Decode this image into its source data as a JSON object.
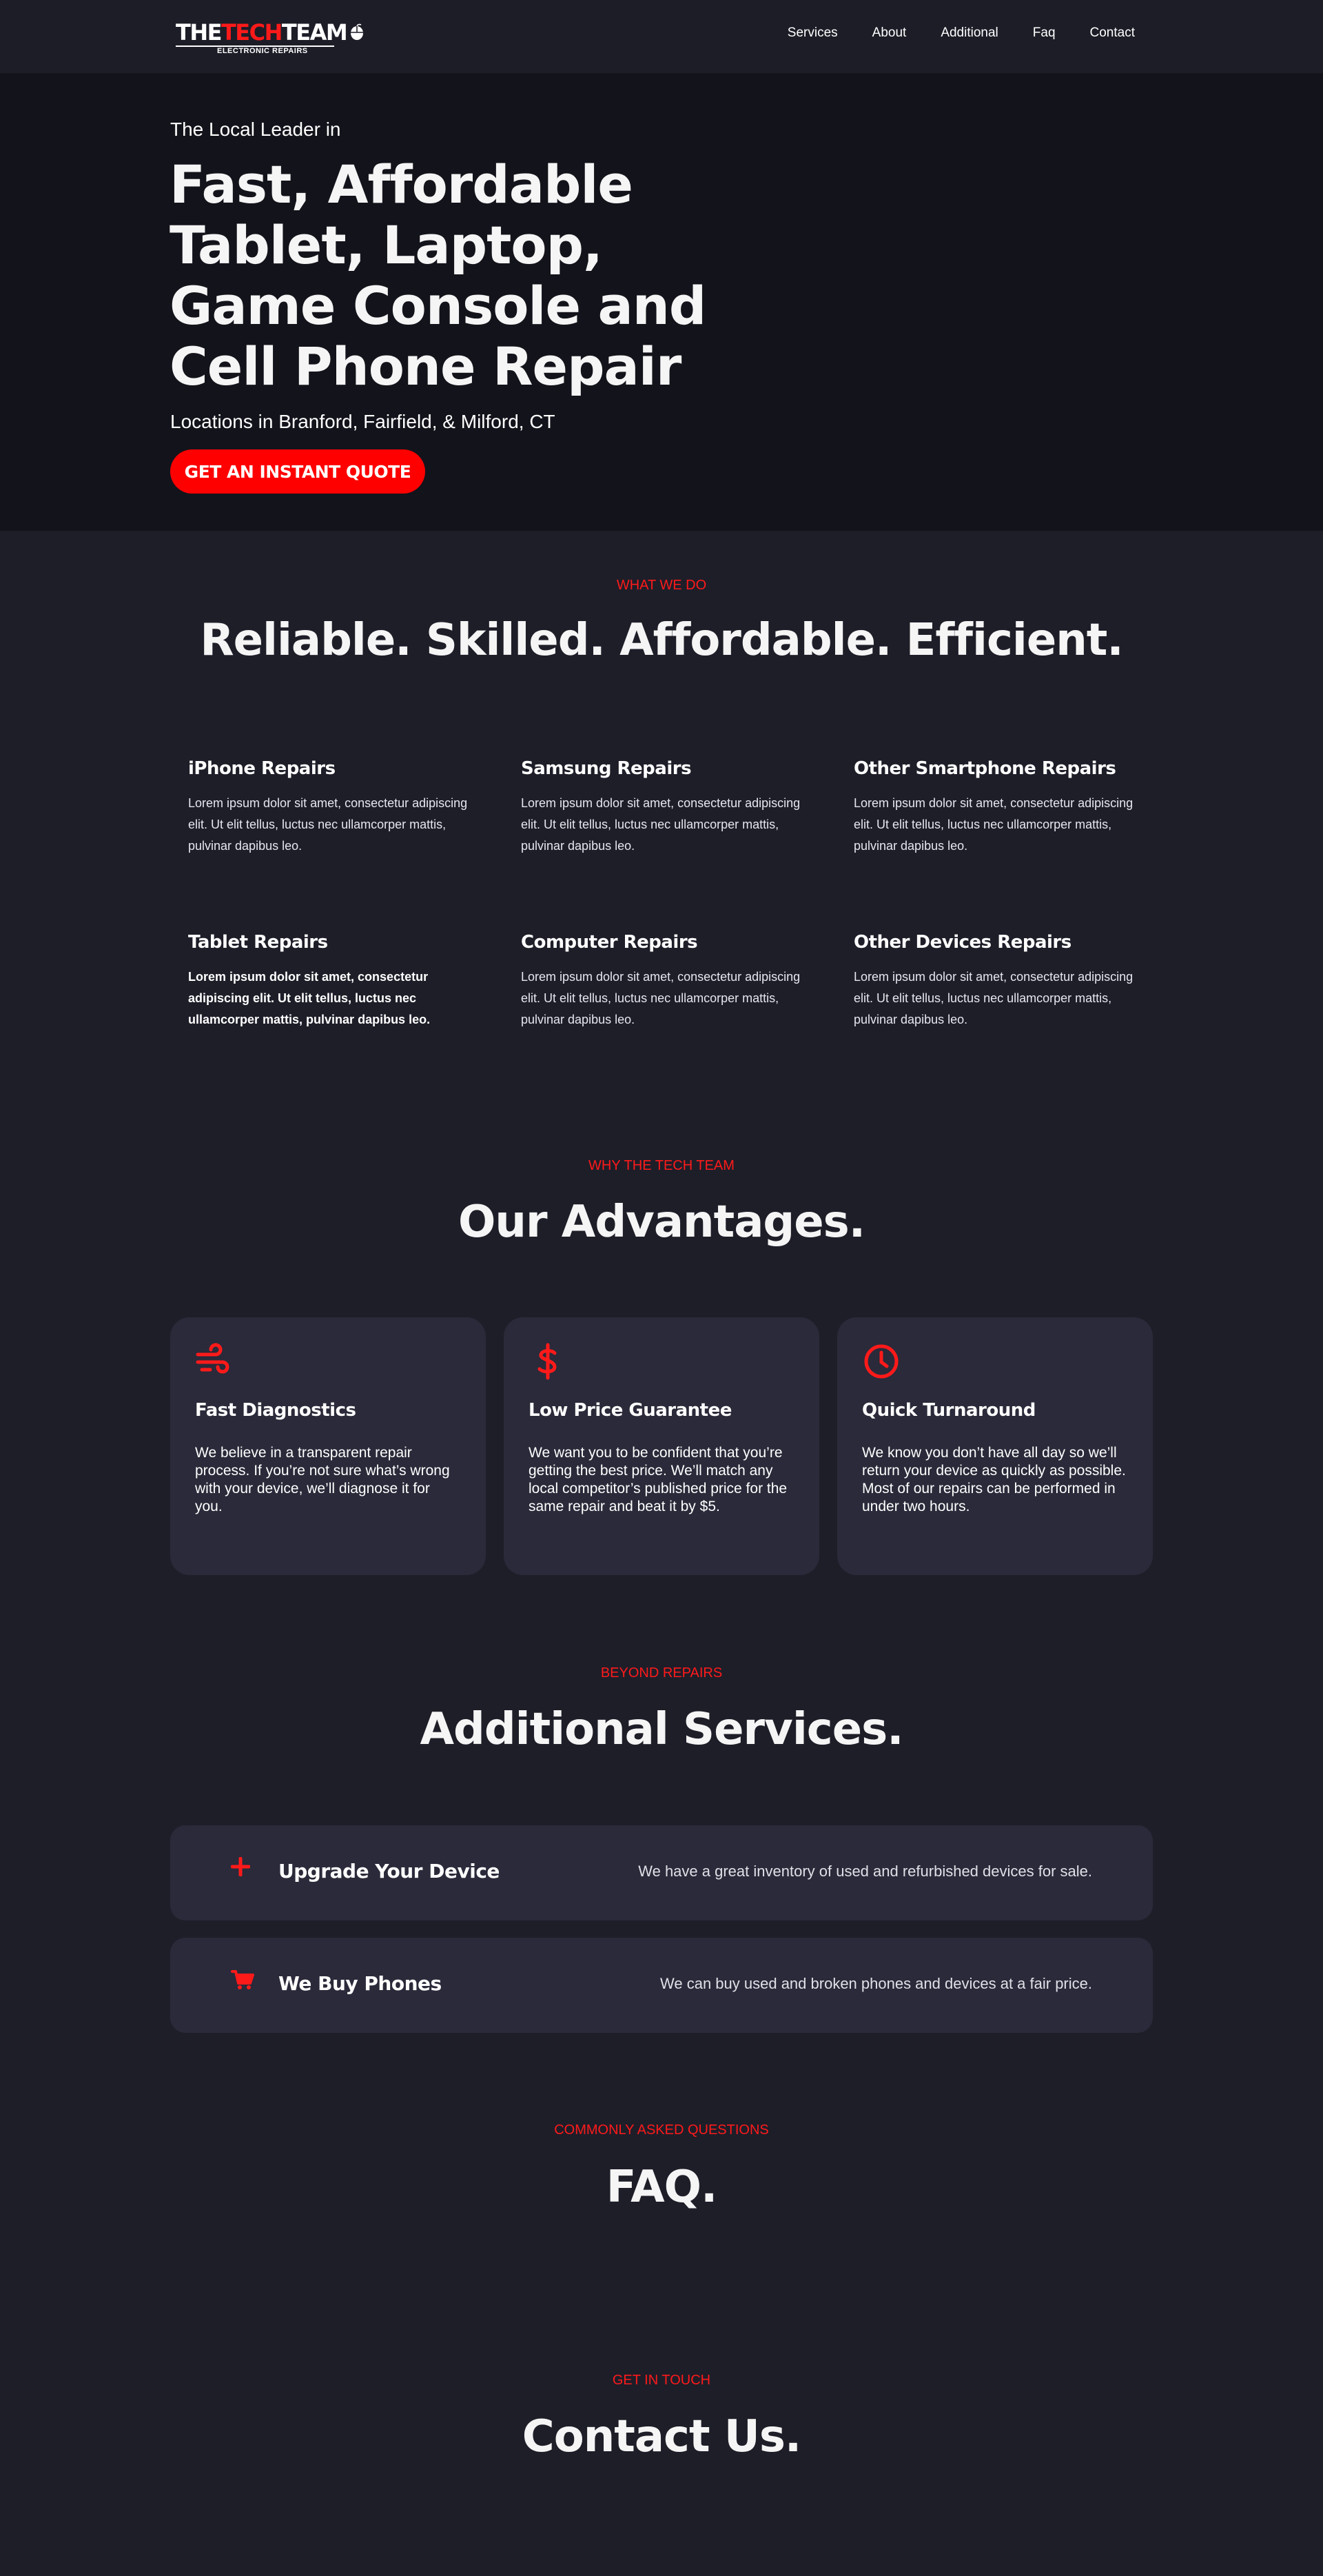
{
  "brand": {
    "name_part1": "THE",
    "name_part2": "TECH",
    "name_part3": "TEAM",
    "tagline": "ELECTRONIC REPAIRS"
  },
  "nav": [
    "Services",
    "About",
    "Additional",
    "Faq",
    "Contact"
  ],
  "hero": {
    "pre": "The Local Leader in",
    "title": "Fast, Affordable Tablet, Laptop, Game Console and Cell Phone Repair",
    "locations": "Locations in Branford, Fairfield, & Milford, CT",
    "cta": "GET AN INSTANT QUOTE"
  },
  "services": {
    "eyebrow": "WHAT WE DO",
    "title": "Reliable. Skilled. Affordable. Efficient.",
    "items": [
      {
        "title": "iPhone Repairs",
        "text": "Lorem ipsum dolor sit amet, consectetur adipiscing elit. Ut elit tellus, luctus nec ullamcorper mattis, pulvinar dapibus leo."
      },
      {
        "title": "Samsung Repairs",
        "text": "Lorem ipsum dolor sit amet, consectetur adipiscing elit. Ut elit tellus, luctus nec ullamcorper mattis, pulvinar dapibus leo."
      },
      {
        "title": "Other Smartphone Repairs",
        "text": "Lorem ipsum dolor sit amet, consectetur adipiscing elit. Ut elit tellus, luctus nec ullamcorper mattis, pulvinar dapibus leo."
      },
      {
        "title": "Tablet Repairs",
        "text": "Lorem ipsum dolor sit amet, consectetur adipiscing elit. Ut elit tellus, luctus nec ullamcorper mattis, pulvinar dapibus leo."
      },
      {
        "title": "Computer Repairs",
        "text": "Lorem ipsum dolor sit amet, consectetur adipiscing elit. Ut elit tellus, luctus nec ullamcorper mattis, pulvinar dapibus leo."
      },
      {
        "title": "Other Devices Repairs",
        "text": "Lorem ipsum dolor sit amet, consectetur adipiscing elit. Ut elit tellus, luctus nec ullamcorper mattis, pulvinar dapibus leo."
      }
    ]
  },
  "advantages": {
    "eyebrow": "WHY THE TECH TEAM",
    "title": "Our Advantages.",
    "cards": [
      {
        "icon": "wind-icon",
        "title": "Fast Diagnostics",
        "text": "We believe in a transparent repair process. If you’re not sure what’s wrong with your device, we’ll diagnose it for you."
      },
      {
        "icon": "dollar-icon",
        "title": "Low Price Guarantee",
        "text": "We want you to be confident that you’re getting the best price. We’ll match any local competitor’s published price for the same repair and beat it by $5."
      },
      {
        "icon": "clock-icon",
        "title": "Quick Turnaround",
        "text": "We know you don’t have all day so we’ll return your device as quickly as possible. Most of our repairs can be performed in under two hours."
      }
    ]
  },
  "additional": {
    "eyebrow": "BEYOND REPAIRS",
    "title": "Additional Services.",
    "items": [
      {
        "icon": "plus-icon",
        "title": "Upgrade Your Device",
        "text": "We have a great inventory of used and refurbished devices for sale."
      },
      {
        "icon": "cart-icon",
        "title": "We Buy Phones",
        "text": "We can buy used and broken phones and devices at a fair price."
      }
    ]
  },
  "faq": {
    "eyebrow": "COMMONLY ASKED QUESTIONS",
    "title": "FAQ."
  },
  "contact": {
    "eyebrow": "GET IN TOUCH",
    "title": "Contact Us."
  },
  "colors": {
    "accent": "#ff0000",
    "header_bg": "#1d1d28",
    "hero_bg": "#13131b",
    "page_bg": "#1e1e29",
    "card_bg": "#2a2a3a"
  }
}
